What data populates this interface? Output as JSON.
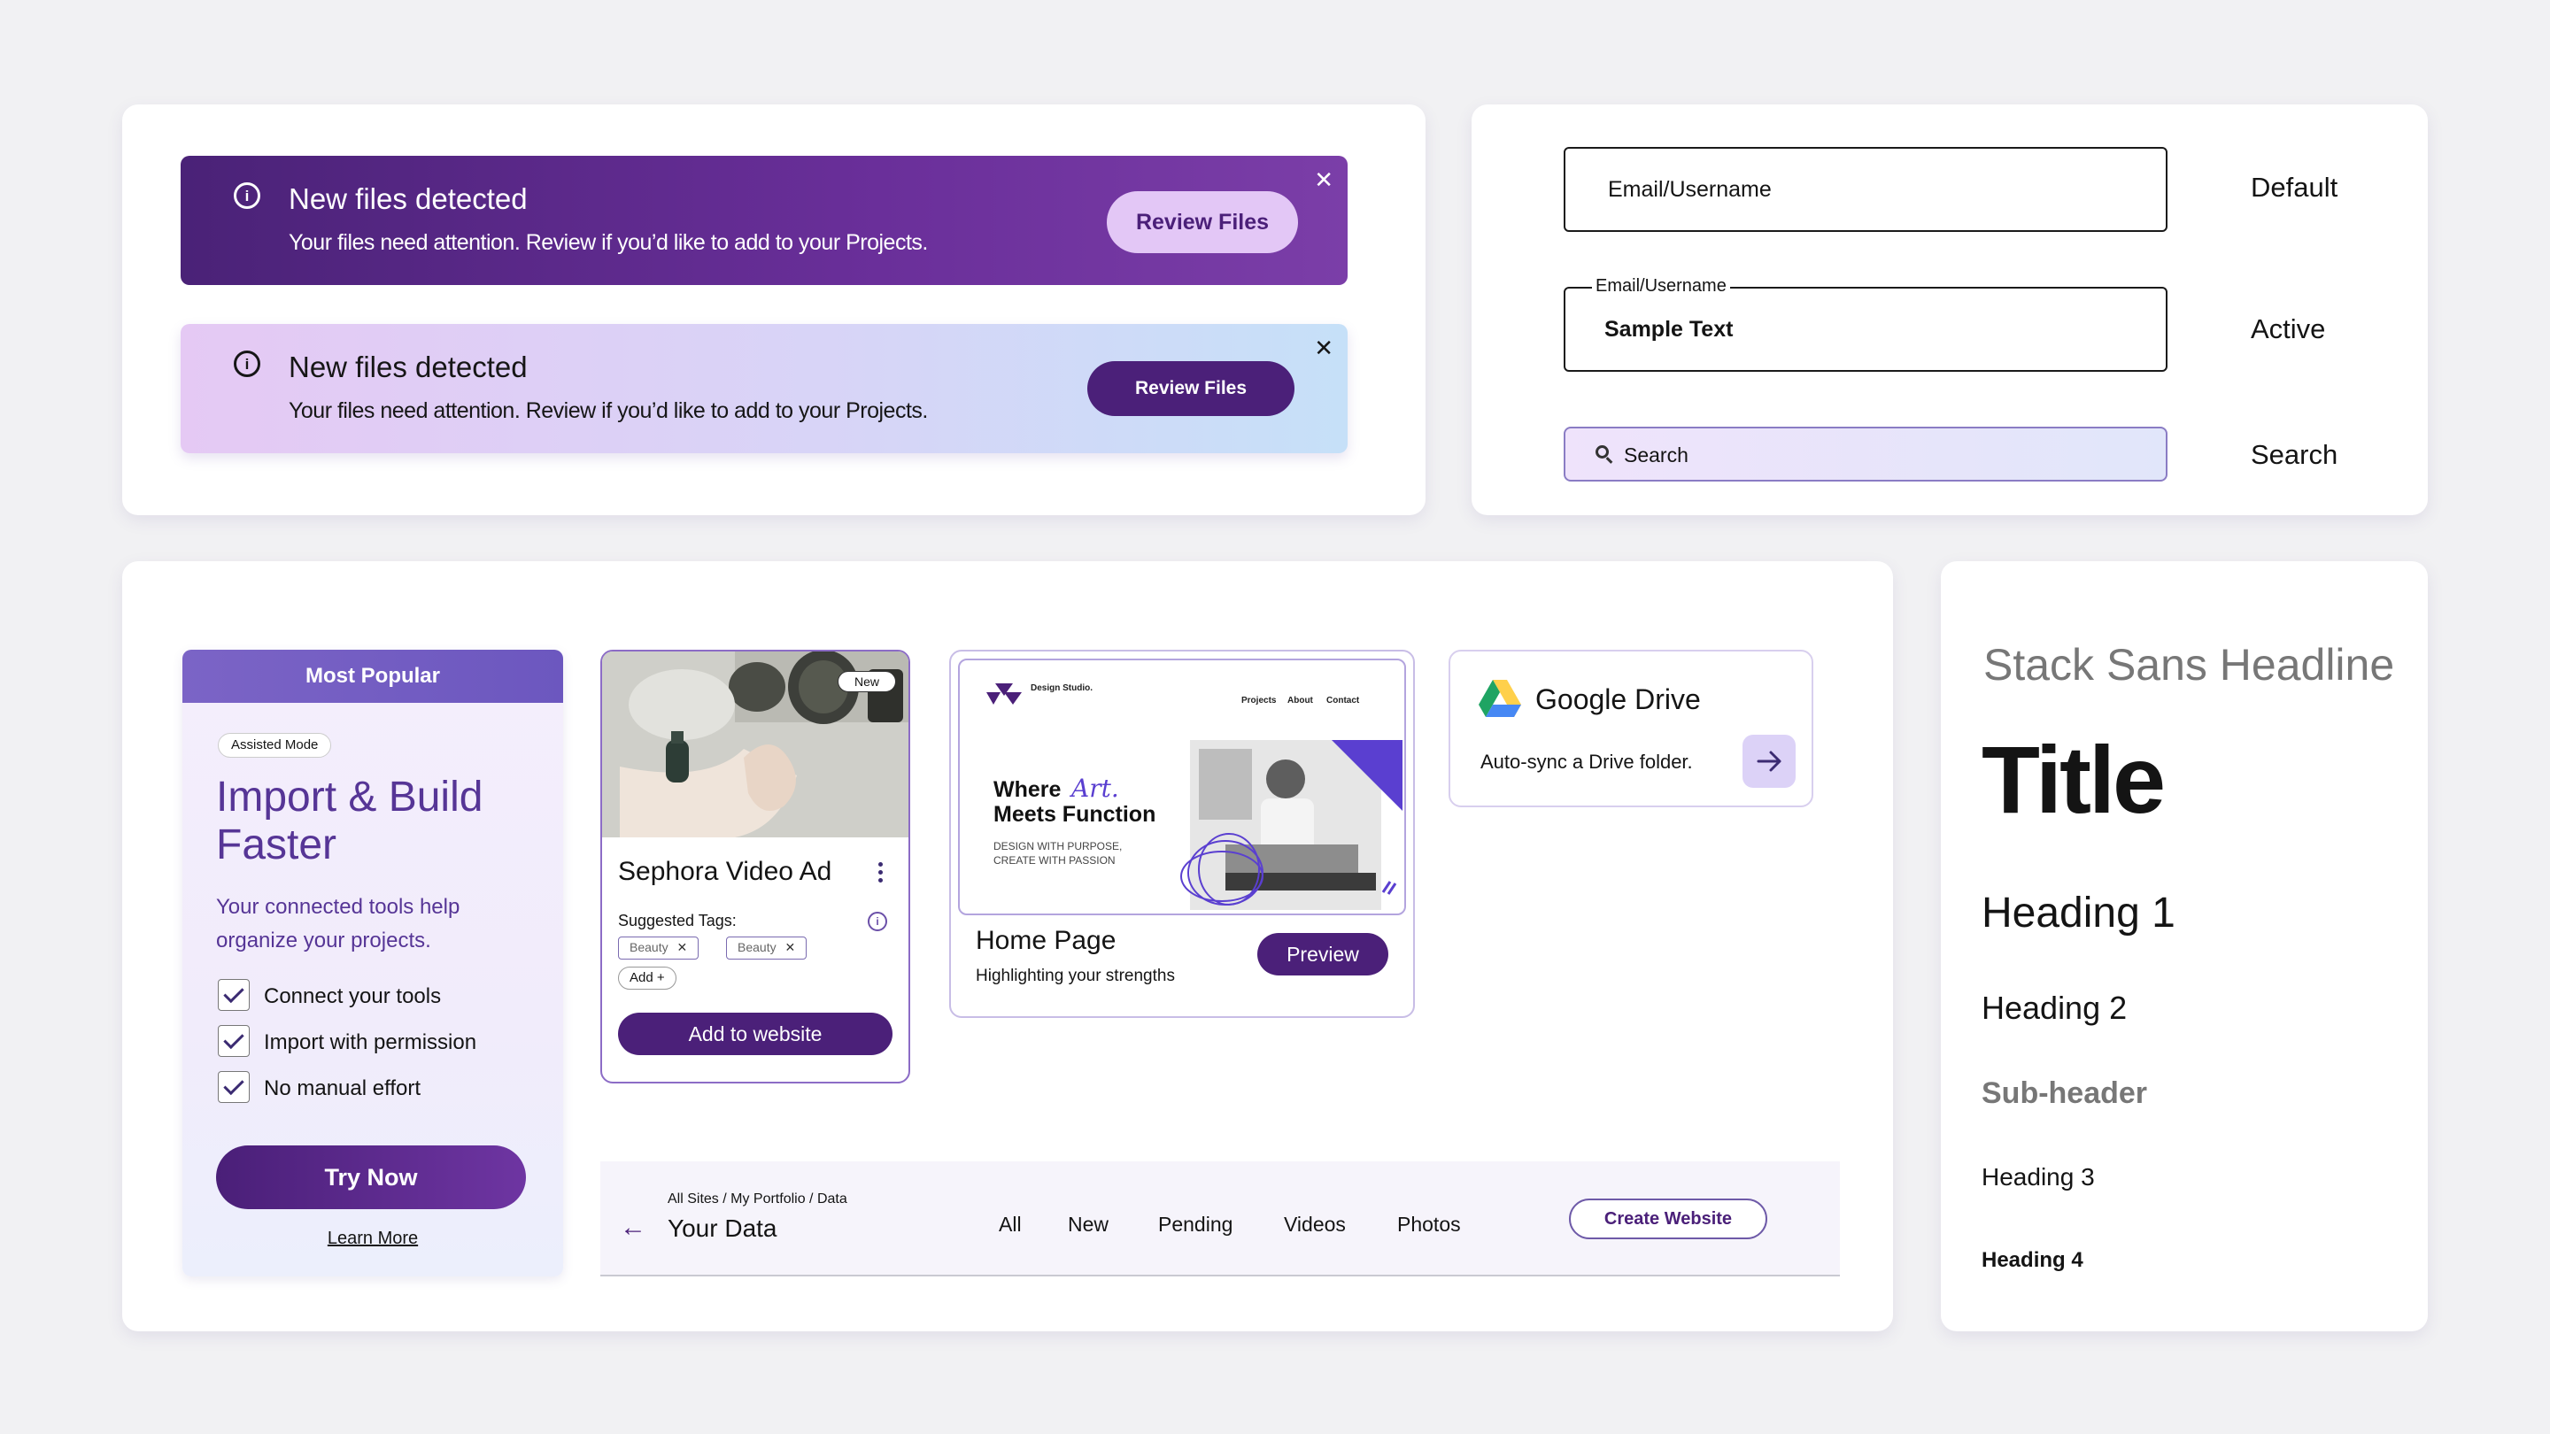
{
  "banners": [
    {
      "title": "New files detected",
      "message": "Your files need attention. Review if you’d like to add to your Projects.",
      "button": "Review Files",
      "close": "✕",
      "info": "i"
    },
    {
      "title": "New files detected",
      "message": "Your files need attention. Review if you’d like to add to your Projects.",
      "button": "Review Files",
      "close": "✕",
      "info": "i"
    }
  ],
  "inputs": {
    "default": {
      "placeholder": "Email/Username",
      "state_label": "Default"
    },
    "active": {
      "legend": "Email/Username",
      "value": "Sample Text",
      "state_label": "Active"
    },
    "search": {
      "placeholder": "Search",
      "state_label": "Search"
    }
  },
  "promo": {
    "header": "Most Popular",
    "mode_pill": "Assisted Mode",
    "title_line1": "Import & Build",
    "title_line2": "Faster",
    "description": "Your connected tools help organize your projects.",
    "checklist": [
      "Connect your tools",
      "Import with permission",
      "No manual effort"
    ],
    "cta": "Try Now",
    "link": "Learn More"
  },
  "video_card": {
    "badge": "New",
    "title": "Sephora Video Ad",
    "suggested_label": "Suggested Tags:",
    "tags": [
      "Beauty",
      "Beauty"
    ],
    "add_tag": "Add +",
    "cta": "Add to website"
  },
  "home_card": {
    "site_logo": "Design Studio.",
    "site_nav": [
      "Projects",
      "About",
      "Contact"
    ],
    "hero_line1_a": "Where",
    "hero_line1_b": "Art.",
    "hero_line2": "Meets Function",
    "hero_sub1": "DESIGN   WITH   PURPOSE,",
    "hero_sub2": "CREATE WITH PASSION",
    "title": "Home Page",
    "subtitle": "Highlighting your strengths",
    "cta": "Preview"
  },
  "gdrive": {
    "title": "Google Drive",
    "subtitle": "Auto-sync a Drive folder.",
    "colors": {
      "green": "#1FA463",
      "yellow": "#FFD04B",
      "blue": "#4688F4"
    }
  },
  "nav": {
    "breadcrumb": "All Sites / My Portfolio / Data",
    "title": "Your Data",
    "tabs": [
      "All",
      "New",
      "Pending",
      "Videos",
      "Photos"
    ],
    "cta": "Create Website"
  },
  "typography": {
    "headline": "Stack Sans Headline",
    "title": "Title",
    "h1": "Heading 1",
    "h2": "Heading 2",
    "subheader": "Sub-header",
    "h3": "Heading 3",
    "h4": "Heading 4"
  },
  "colors": {
    "brand_purple": "#4B2079",
    "accent_lilac": "#E3C7F6",
    "background": "#F1F1F3"
  }
}
